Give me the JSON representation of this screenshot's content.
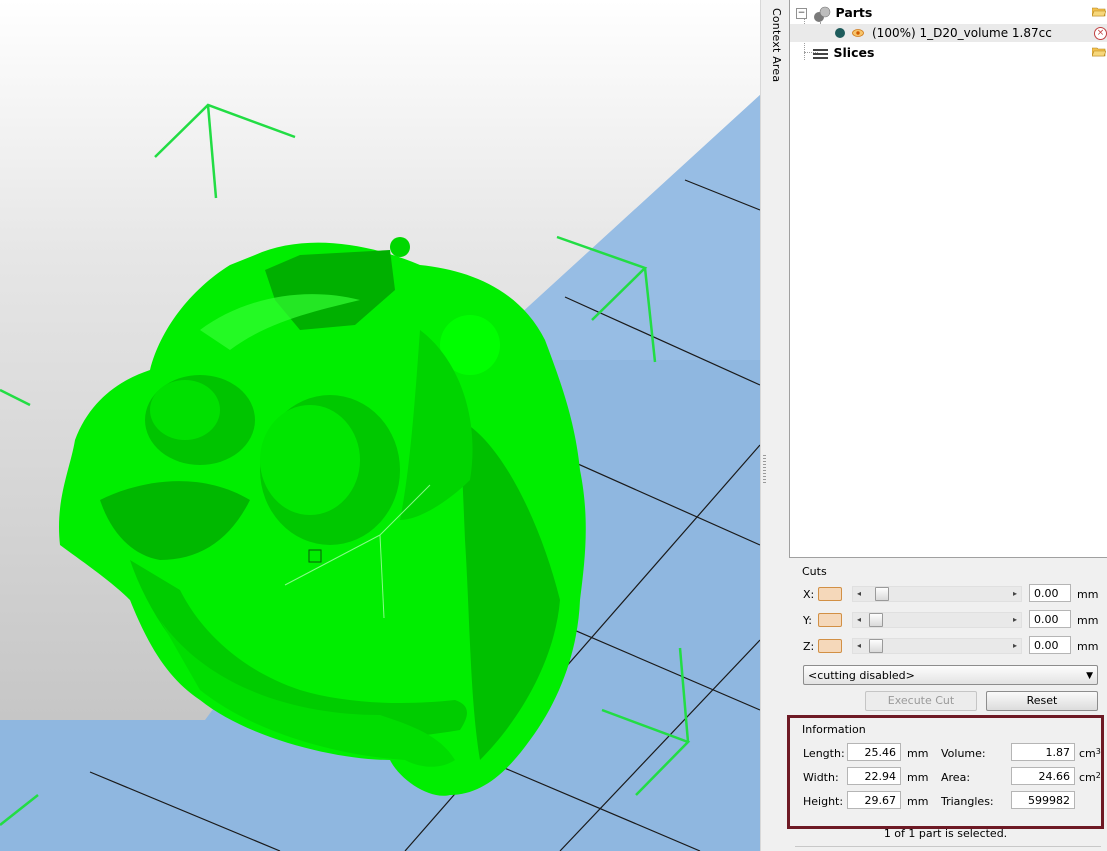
{
  "context_area": {
    "label": "Context Area"
  },
  "tree": {
    "parts_label": "Parts",
    "part_item_label": "(100%) 1_D20_volume 1.87cc",
    "slices_label": "Slices",
    "parts_expander": "−"
  },
  "cuts": {
    "title": "Cuts",
    "axes": [
      {
        "label": "X:",
        "value": "0.00",
        "unit": "mm"
      },
      {
        "label": "Y:",
        "value": "0.00",
        "unit": "mm"
      },
      {
        "label": "Z:",
        "value": "0.00",
        "unit": "mm"
      }
    ],
    "mode_select": "<cutting disabled>",
    "execute_label": "Execute Cut",
    "reset_label": "Reset"
  },
  "information": {
    "title": "Information",
    "length_label": "Length:",
    "length_value": "25.46",
    "length_unit": "mm",
    "width_label": "Width:",
    "width_value": "22.94",
    "width_unit": "mm",
    "height_label": "Height:",
    "height_value": "29.67",
    "height_unit": "mm",
    "volume_label": "Volume:",
    "volume_value": "1.87",
    "volume_unit": "cm",
    "area_label": "Area:",
    "area_value": "24.66",
    "area_unit": "cm",
    "triangles_label": "Triangles:",
    "triangles_value": "599982"
  },
  "status": {
    "selection_text": "1 of 1 part is selected."
  },
  "colors": {
    "model_green": "#00ee00",
    "platform_blue": "#8fb7e0",
    "info_border": "#6e1a25",
    "axis_green": "#22dd44"
  },
  "icons": {
    "parts": "parts-spheres-icon",
    "visibility": "eye-icon",
    "folder": "folder-open-icon",
    "remove": "close-icon",
    "slices": "slices-stack-icon"
  }
}
